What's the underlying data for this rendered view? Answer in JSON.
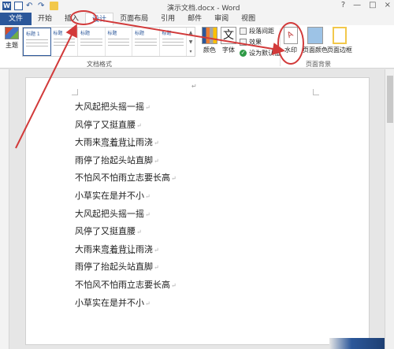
{
  "window": {
    "title": "演示文档.docx - Word",
    "controls": [
      "?",
      "—",
      "□",
      "×"
    ]
  },
  "quick_access": {
    "icons": [
      "word-icon",
      "save-icon",
      "undo-icon",
      "redo-icon",
      "open-folder-icon"
    ],
    "word_letter": "W"
  },
  "tabs": [
    {
      "label": "文件"
    },
    {
      "label": "开始"
    },
    {
      "label": "插入"
    },
    {
      "label": "设计"
    },
    {
      "label": "页面布局"
    },
    {
      "label": "引用"
    },
    {
      "label": "邮件"
    },
    {
      "label": "审阅"
    },
    {
      "label": "视图"
    }
  ],
  "active_tab": "设计",
  "ribbon": {
    "themes_label": "主题",
    "gallery": {
      "items": [
        {
          "heading": "标题 1"
        },
        {
          "heading": "标题"
        },
        {
          "heading": "标题"
        },
        {
          "heading": "标题"
        },
        {
          "heading": "标题"
        },
        {
          "heading": "标题"
        }
      ],
      "group_label": "文档格式"
    },
    "colors_label": "颜色",
    "fonts_label": "字体",
    "paragraph_spacing_label": "段落间距",
    "effects_label": "效果",
    "set_default_label": "设为默认值",
    "watermark_label": "水印",
    "page_color_label": "页面颜色",
    "page_border_label": "页面边框",
    "page_background_group_label": "页面背景"
  },
  "document": {
    "lines": [
      {
        "pre": "大风起把头摇一摇",
        "u": "",
        "post": ""
      },
      {
        "pre": "风停了又挺直腰",
        "u": "",
        "post": ""
      },
      {
        "pre": "大雨来",
        "u": "弯着背让",
        "post": "雨浇"
      },
      {
        "pre": "雨停了抬起头站直脚",
        "u": "",
        "post": ""
      },
      {
        "pre": "不怕风不怕雨立志要长高",
        "u": "",
        "post": ""
      },
      {
        "pre": "小草实在是并不小",
        "u": "",
        "post": ""
      },
      {
        "pre": "大风起把头摇一摇",
        "u": "",
        "post": ""
      },
      {
        "pre": "风停了又挺直腰",
        "u": "",
        "post": ""
      },
      {
        "pre": "大雨来",
        "u": "弯着背让",
        "post": "雨浇"
      },
      {
        "pre": "雨停了抬起头站直脚",
        "u": "",
        "post": ""
      },
      {
        "pre": "不怕风不怕雨立志要长高",
        "u": "",
        "post": ""
      },
      {
        "pre": "小草实在是并不小",
        "u": "",
        "post": ""
      }
    ],
    "paragraph_mark": "↵"
  },
  "colors": {
    "accent": "#2b579a",
    "annotation": "#d23a3a"
  }
}
